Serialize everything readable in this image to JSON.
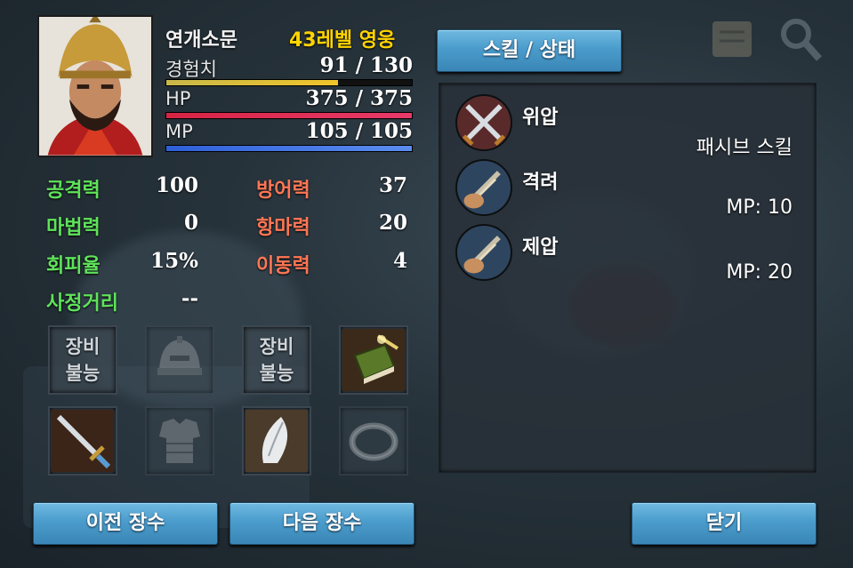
{
  "hero": {
    "name": "연개소문",
    "level_text": "43레벨 영웅",
    "exp": {
      "label": "경험치",
      "value": "91 / 130",
      "ratio": 0.7
    },
    "hp": {
      "label": "HP",
      "value": "375 / 375",
      "ratio": 1.0
    },
    "mp": {
      "label": "MP",
      "value": "105 / 105",
      "ratio": 1.0
    }
  },
  "attributes": {
    "attack": {
      "label": "공격력",
      "value": "100"
    },
    "defense": {
      "label": "방어력",
      "value": "37"
    },
    "magic": {
      "label": "마법력",
      "value": "0"
    },
    "magic_resist": {
      "label": "항마력",
      "value": "20"
    },
    "evasion": {
      "label": "회피율",
      "value": "15%"
    },
    "movement": {
      "label": "이동력",
      "value": "4"
    },
    "range": {
      "label": "사정거리",
      "value": "--"
    }
  },
  "equipment": {
    "slot1_text": "장비 불능",
    "slot3_text": "장비 불능",
    "slots": [
      {
        "name": "unusable",
        "icon": "none"
      },
      {
        "name": "helmet",
        "icon": "helmet-icon"
      },
      {
        "name": "unusable",
        "icon": "none"
      },
      {
        "name": "book",
        "icon": "book-icon"
      },
      {
        "name": "sword",
        "icon": "sword-icon"
      },
      {
        "name": "armor",
        "icon": "armor-icon"
      },
      {
        "name": "feather",
        "icon": "feather-icon"
      },
      {
        "name": "ring",
        "icon": "ring-icon"
      }
    ]
  },
  "buttons": {
    "prev": "이전 장수",
    "next": "다음 장수",
    "close": "닫기",
    "skill_tab": "스킬 / 상태"
  },
  "skills": [
    {
      "name": "위압",
      "info": "패시브 스킬",
      "icon": "crossed-swords-icon"
    },
    {
      "name": "격려",
      "info": "MP: 10",
      "icon": "sword-hand-icon"
    },
    {
      "name": "제압",
      "info": "MP: 20",
      "icon": "sword-hand-icon"
    }
  ],
  "colors": {
    "button": "#4a9ccc",
    "stat_green": "#5fe35a",
    "stat_red": "#ff7755",
    "level_gold": "#ffd400",
    "exp_bar": "#f0c52b",
    "hp_bar": "#e83a6a",
    "mp_bar": "#5b8df0"
  }
}
